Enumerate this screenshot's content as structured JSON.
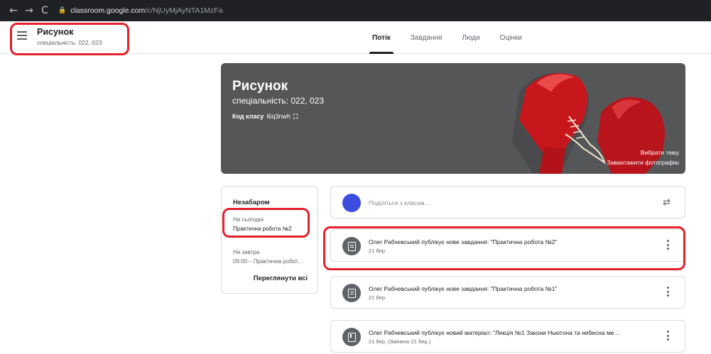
{
  "browser": {
    "back": "←",
    "forward": "→",
    "reload": "C",
    "url_host": "classroom.google.com",
    "url_path": "/c/NjUyMjAyNTA1MzFa"
  },
  "header": {
    "class_name": "Рисунок",
    "class_subtitle": "спеціальність: 022, 023",
    "tabs": [
      "Потік",
      "Завдання",
      "Люди",
      "Оцінки"
    ],
    "active_tab": "Потік"
  },
  "banner": {
    "title": "Рисунок",
    "subtitle": "спеціальність:  022, 023",
    "code_label": "Код класу",
    "code_value": "l6q3nwh",
    "choose_theme": "Вибрати тему",
    "upload_photo": "Завантажити фотографію"
  },
  "upcoming": {
    "title": "Незабаром",
    "today_label": "На сьогодні",
    "today_item": "Практична робота №2",
    "tomorrow_label": "На завтра",
    "tomorrow_item": "09:00 – Практична робот…",
    "view_all": "Переглянути всі"
  },
  "stream": {
    "share_placeholder": "Поділіться з класом…",
    "posts": [
      {
        "title": "Олег Рабчевський публікує нове завдання: \"Практична робота №2\"",
        "date": "21 бер.",
        "icon": "assignment-icon"
      },
      {
        "title": "Олег Рабчевський публікує нове завдання: \"Практична робота №1\"",
        "date": "21 бер.",
        "icon": "assignment-icon"
      },
      {
        "title": "Олег Рабчевський публікує новий матеріал: \"Лекція №1 Закони Ньютона та небесна ме…",
        "date": "21 бер. (Змінено 21 бер.)",
        "icon": "material-icon"
      }
    ]
  },
  "colors": {
    "highlight": "#e4202a",
    "banner_bg": "#555658",
    "avatar": "#3c4ee0",
    "post_icon": "#5f6368"
  }
}
